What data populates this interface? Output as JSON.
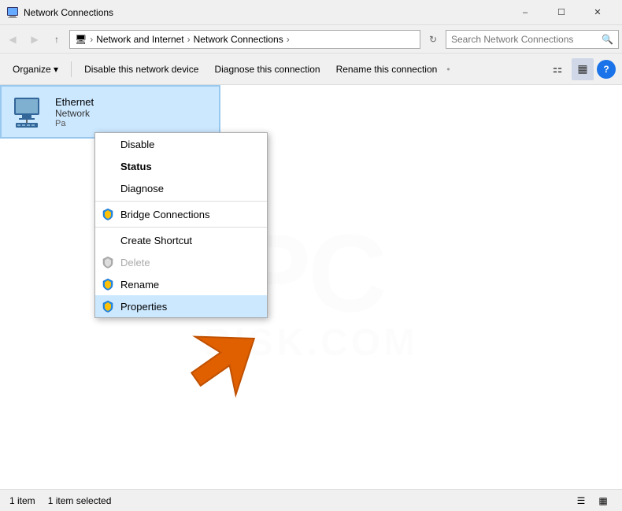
{
  "titlebar": {
    "title": "Network Connections",
    "icon": "network-connections-icon",
    "min_label": "–",
    "max_label": "☐",
    "close_label": "✕"
  },
  "addressbar": {
    "back_icon": "◀",
    "forward_icon": "▶",
    "up_icon": "↑",
    "breadcrumb": [
      {
        "label": "Network and Internet",
        "sep": "›"
      },
      {
        "label": "Network Connections",
        "sep": "›"
      }
    ],
    "search_placeholder": "Search Network Connections",
    "search_icon": "🔍"
  },
  "toolbar": {
    "organize_label": "Organize ▾",
    "disable_label": "Disable this network device",
    "diagnose_label": "Diagnose this connection",
    "rename_label": "Rename this connection",
    "sep_label": "•",
    "view_icon1": "⚏",
    "view_icon2": "▦",
    "help_label": "?"
  },
  "ethernet": {
    "name": "Ethernet",
    "type": "Network",
    "status": "Pa"
  },
  "contextmenu": {
    "items": [
      {
        "label": "Disable",
        "icon": null,
        "style": "normal"
      },
      {
        "label": "Status",
        "icon": null,
        "style": "bold"
      },
      {
        "label": "Diagnose",
        "icon": null,
        "style": "normal"
      },
      {
        "sep": true
      },
      {
        "label": "Bridge Connections",
        "icon": "shield",
        "style": "normal"
      },
      {
        "sep": true
      },
      {
        "label": "Create Shortcut",
        "icon": null,
        "style": "normal"
      },
      {
        "label": "Delete",
        "icon": "shield",
        "style": "disabled"
      },
      {
        "label": "Rename",
        "icon": "shield",
        "style": "normal"
      },
      {
        "sep": false
      },
      {
        "label": "Properties",
        "icon": "shield",
        "style": "highlighted"
      }
    ]
  },
  "statusbar": {
    "count": "1 item",
    "selected": "1 item selected"
  }
}
